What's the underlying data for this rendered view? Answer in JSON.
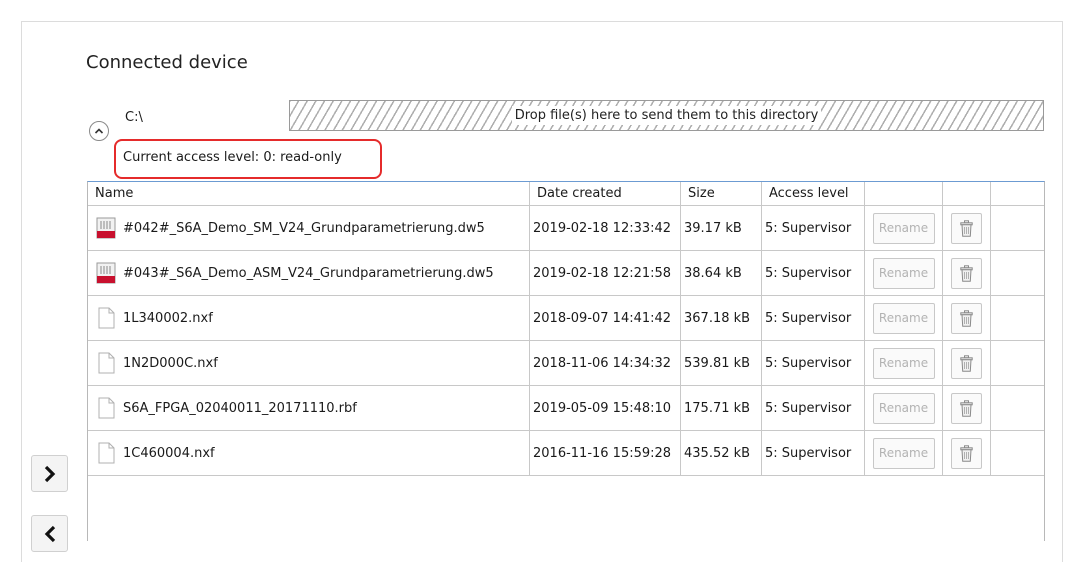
{
  "section": {
    "title": "Connected device"
  },
  "path": {
    "current": "C:\\"
  },
  "drop_zone": {
    "text": "Drop file(s) here to send them to this directory"
  },
  "access": {
    "label": "Current access level:  0: read-only",
    "highlight_color": "#e52b2b"
  },
  "table": {
    "columns": [
      "Name",
      "Date created",
      "Size",
      "Access level",
      "",
      "",
      ""
    ],
    "rename_label": "Rename",
    "rows": [
      {
        "icon": "keb-file-icon",
        "name": "#042#_S6A_Demo_SM_V24_Grundparametrierung.dw5",
        "date": "2019-02-18 12:33:42",
        "size": "39.17 kB",
        "access": "5: Supervisor"
      },
      {
        "icon": "keb-file-icon",
        "name": "#043#_S6A_Demo_ASM_V24_Grundparametrierung.dw5",
        "date": "2019-02-18 12:21:58",
        "size": "38.64 kB",
        "access": "5: Supervisor"
      },
      {
        "icon": "document-icon",
        "name": "1L340002.nxf",
        "date": "2018-09-07 14:41:42",
        "size": "367.18 kB",
        "access": "5: Supervisor"
      },
      {
        "icon": "document-icon",
        "name": "1N2D000C.nxf",
        "date": "2018-11-06 14:34:32",
        "size": "539.81 kB",
        "access": "5: Supervisor"
      },
      {
        "icon": "document-icon",
        "name": "S6A_FPGA_02040011_20171110.rbf",
        "date": "2019-05-09 15:48:10",
        "size": "175.71 kB",
        "access": "5: Supervisor"
      },
      {
        "icon": "document-icon",
        "name": "1C460004.nxf",
        "date": "2016-11-16 15:59:28",
        "size": "435.52 kB",
        "access": "5: Supervisor"
      }
    ]
  },
  "nav": {
    "forward_icon": "chevron-right-icon",
    "back_icon": "chevron-left-icon"
  },
  "colors": {
    "header_accent": "#6c9bd2",
    "keb_red": "#c8102e"
  }
}
